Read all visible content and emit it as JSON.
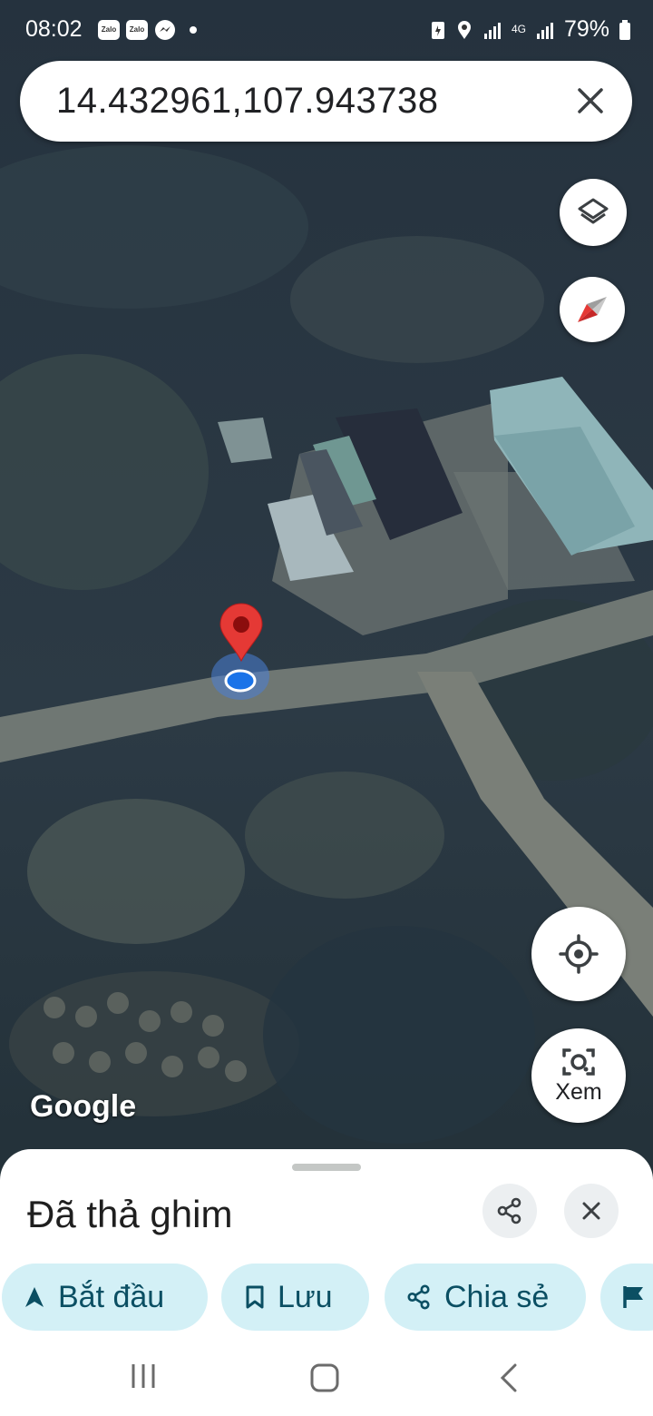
{
  "status_bar": {
    "time": "08:02",
    "notification_icons": [
      "zalo-icon",
      "zalo-icon",
      "messenger-icon",
      "dot-icon"
    ],
    "battery": "79%",
    "network": "4G"
  },
  "search": {
    "query": "14.432961,107.943738"
  },
  "map": {
    "attribution": "Google",
    "view_type": "satellite"
  },
  "lens": {
    "label": "Xem"
  },
  "bottom_sheet": {
    "title": "Đã thả ghim",
    "chips": [
      {
        "label": "Bắt đầu",
        "icon": "navigation-arrow-icon"
      },
      {
        "label": "Lưu",
        "icon": "bookmark-icon"
      },
      {
        "label": "Chia sẻ",
        "icon": "share-icon"
      },
      {
        "label": "",
        "icon": "flag-icon"
      }
    ]
  },
  "colors": {
    "chip_bg": "#d3f0f6",
    "chip_text": "#0b4f63",
    "pin": "#e53935",
    "location_dot": "#1a73e8"
  }
}
